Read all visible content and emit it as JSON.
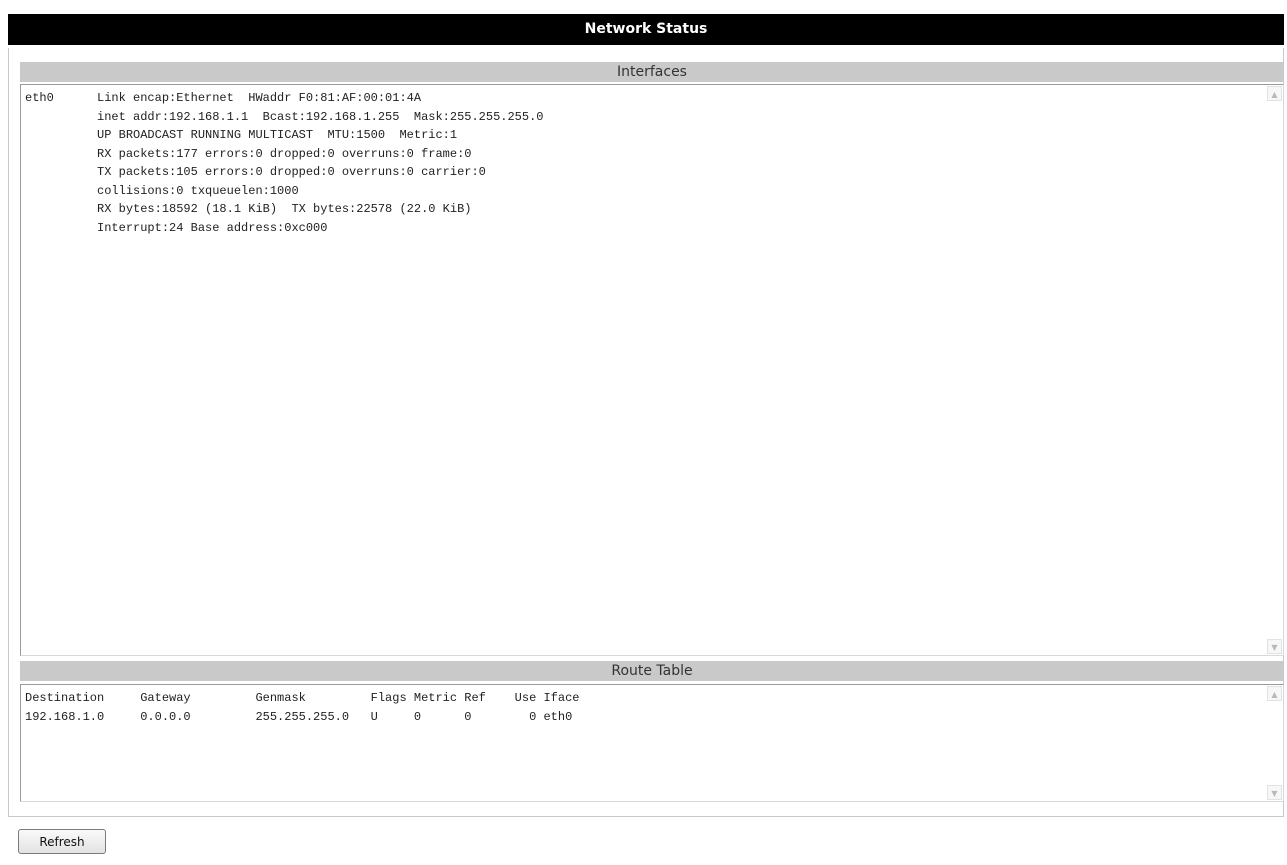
{
  "page": {
    "title": "Network Status"
  },
  "interfaces": {
    "header": "Interfaces",
    "content": "eth0      Link encap:Ethernet  HWaddr F0:81:AF:00:01:4A\n          inet addr:192.168.1.1  Bcast:192.168.1.255  Mask:255.255.255.0\n          UP BROADCAST RUNNING MULTICAST  MTU:1500  Metric:1\n          RX packets:177 errors:0 dropped:0 overruns:0 frame:0\n          TX packets:105 errors:0 dropped:0 overruns:0 carrier:0\n          collisions:0 txqueuelen:1000\n          RX bytes:18592 (18.1 KiB)  TX bytes:22578 (22.0 KiB)\n          Interrupt:24 Base address:0xc000"
  },
  "route_table": {
    "header": "Route Table",
    "content": "Destination     Gateway         Genmask         Flags Metric Ref    Use Iface\n192.168.1.0     0.0.0.0         255.255.255.0   U     0      0        0 eth0"
  },
  "actions": {
    "refresh_label": "Refresh"
  },
  "icons": {
    "scroll_up": "scroll-up-arrow",
    "scroll_down": "scroll-down-arrow"
  }
}
